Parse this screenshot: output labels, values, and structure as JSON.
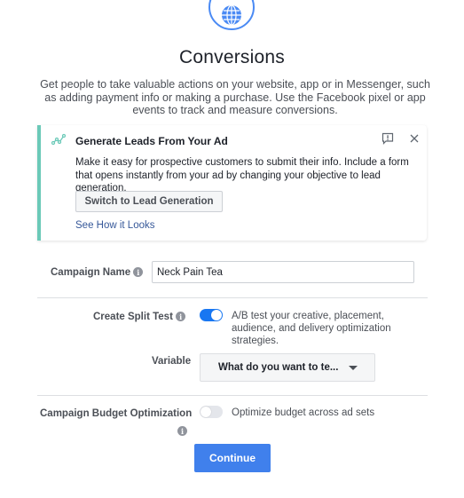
{
  "header": {
    "icon": "globe-icon",
    "title": "Conversions",
    "description": "Get people to take valuable actions on your website, app or in Messenger, such as adding payment info or making a purchase. Use the Facebook pixel or app events to track and measure conversions."
  },
  "lead_card": {
    "icon": "leads-graph-icon",
    "title": "Generate Leads From Your Ad",
    "text": "Make it easy for prospective customers to submit their info. Include a form that opens instantly from your ad by changing your objective to lead generation.",
    "switch_button": "Switch to Lead Generation",
    "link": "See How it Looks",
    "accent_color": "#6bc9b8"
  },
  "campaign_name": {
    "label": "Campaign Name",
    "value": "Neck Pain Tea"
  },
  "split_test": {
    "label": "Create Split Test",
    "enabled": true,
    "help": "A/B test your creative, placement, audience, and delivery optimization strategies."
  },
  "variable": {
    "label": "Variable",
    "placeholder": "What do you want to te..."
  },
  "budget_optimization": {
    "label": "Campaign Budget Optimization",
    "enabled": false,
    "help": "Optimize budget across ad sets"
  },
  "actions": {
    "continue": "Continue",
    "primary_color": "#4080ec"
  }
}
